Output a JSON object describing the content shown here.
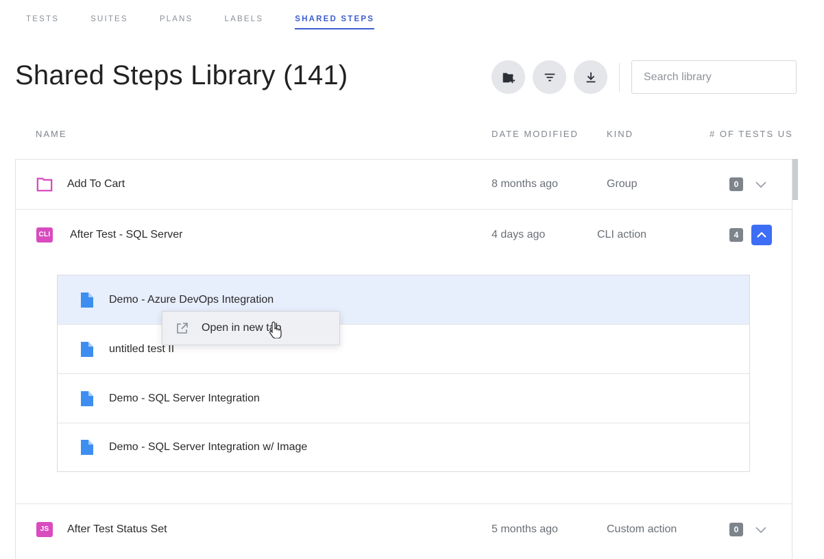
{
  "nav": {
    "tabs": [
      {
        "label": "TESTS",
        "active": false
      },
      {
        "label": "SUITES",
        "active": false
      },
      {
        "label": "PLANS",
        "active": false
      },
      {
        "label": "LABELS",
        "active": false
      },
      {
        "label": "SHARED STEPS",
        "active": true
      }
    ]
  },
  "header": {
    "title": "Shared Steps Library (141)",
    "search_placeholder": "Search library",
    "toolbar_icons": [
      "new-folder-icon",
      "filter-icon",
      "download-icon"
    ]
  },
  "columns": {
    "name": "NAME",
    "date": "DATE MODIFIED",
    "kind": "KIND",
    "tests": "# OF TESTS US"
  },
  "rows": [
    {
      "icon": "folder-icon",
      "name": "Add To Cart",
      "date": "8 months ago",
      "kind": "Group",
      "count": "0",
      "expanded": false
    },
    {
      "icon": "cli-icon",
      "icon_text": "CLI",
      "name": "After Test - SQL Server",
      "date": "4 days ago",
      "kind": "CLI action",
      "count": "4",
      "expanded": true
    },
    {
      "icon": "js-icon",
      "icon_text": "JS",
      "name": "After Test Status Set",
      "date": "5 months ago",
      "kind": "Custom action",
      "count": "0",
      "expanded": false
    }
  ],
  "used_in_tests": [
    {
      "name": "Demo - Azure DevOps Integration",
      "hover": true
    },
    {
      "name": "untitled test II",
      "hover": false
    },
    {
      "name": "Demo - SQL Server Integration",
      "hover": false
    },
    {
      "name": "Demo - SQL Server Integration w/ Image",
      "hover": false
    }
  ],
  "context_menu": {
    "label": "Open in new tab"
  },
  "colors": {
    "accent": "#3d5ccf",
    "badge_pink": "#d94bbf",
    "file_blue": "#3d8ef0",
    "hover_row": "#e7eefc",
    "expand_button": "#3d6ef5"
  }
}
